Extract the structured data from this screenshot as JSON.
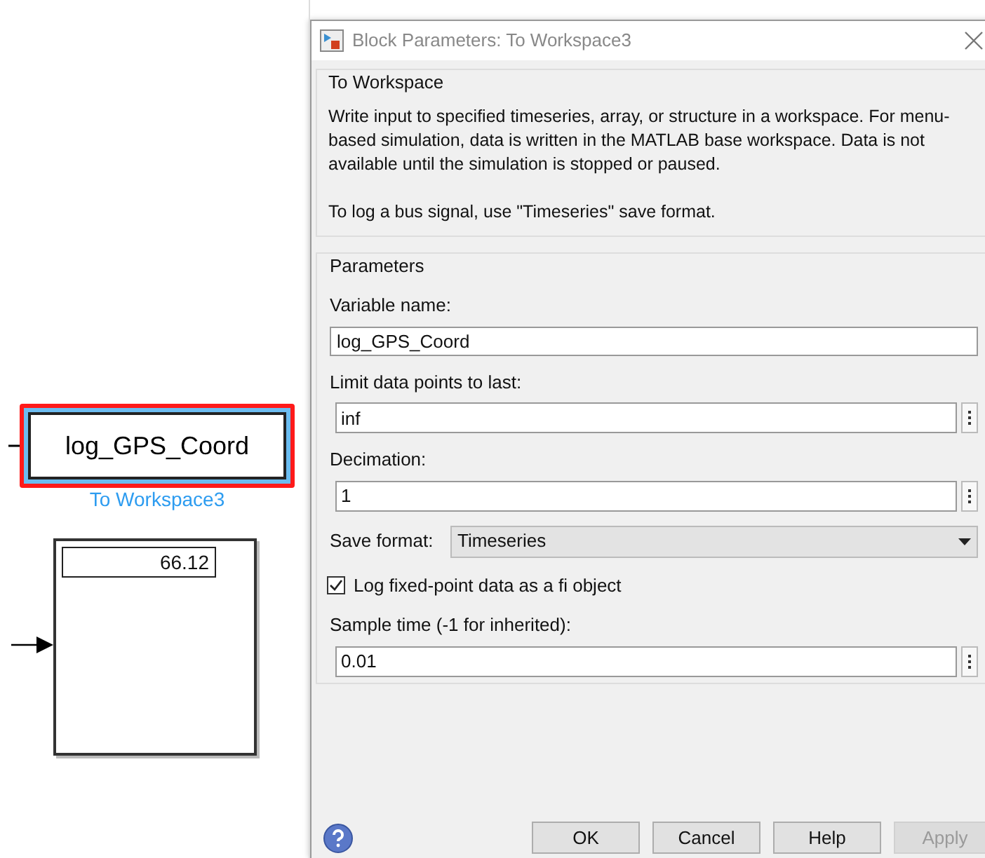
{
  "canvas": {
    "blocks": [
      {
        "kind": "to_workspace",
        "text": "log_GPS_Coord",
        "label": "To Workspace3",
        "selected": true
      },
      {
        "kind": "display",
        "value": "66.12"
      }
    ]
  },
  "dialog": {
    "title": "Block Parameters: To Workspace3",
    "description": {
      "title": "To Workspace",
      "paragraphs": [
        "Write input to specified timeseries, array, or structure in a workspace. For menu-based simulation, data is written in the MATLAB base workspace. Data is not available until the simulation is stopped or paused.",
        "To log a bus signal, use \"Timeseries\" save format."
      ]
    },
    "parameters": {
      "title": "Parameters",
      "fields": [
        {
          "kind": "text",
          "label": "Variable name:",
          "value": "log_GPS_Coord"
        },
        {
          "kind": "menu_text",
          "label": "Limit data points to last:",
          "value": "inf"
        },
        {
          "kind": "menu_text",
          "label": "Decimation:",
          "value": "1"
        },
        {
          "kind": "dropdown",
          "label": "Save format:",
          "value": "Timeseries"
        },
        {
          "kind": "checkbox",
          "label": "Log fixed-point data as a fi object",
          "checked": true
        },
        {
          "kind": "menu_text",
          "label": "Sample time (-1 for inherited):",
          "value": "0.01"
        }
      ]
    },
    "buttons": [
      {
        "label": "OK",
        "disabled": false
      },
      {
        "label": "Cancel",
        "disabled": false
      },
      {
        "label": "Help",
        "disabled": false
      },
      {
        "label": "Apply",
        "disabled": true
      }
    ]
  }
}
